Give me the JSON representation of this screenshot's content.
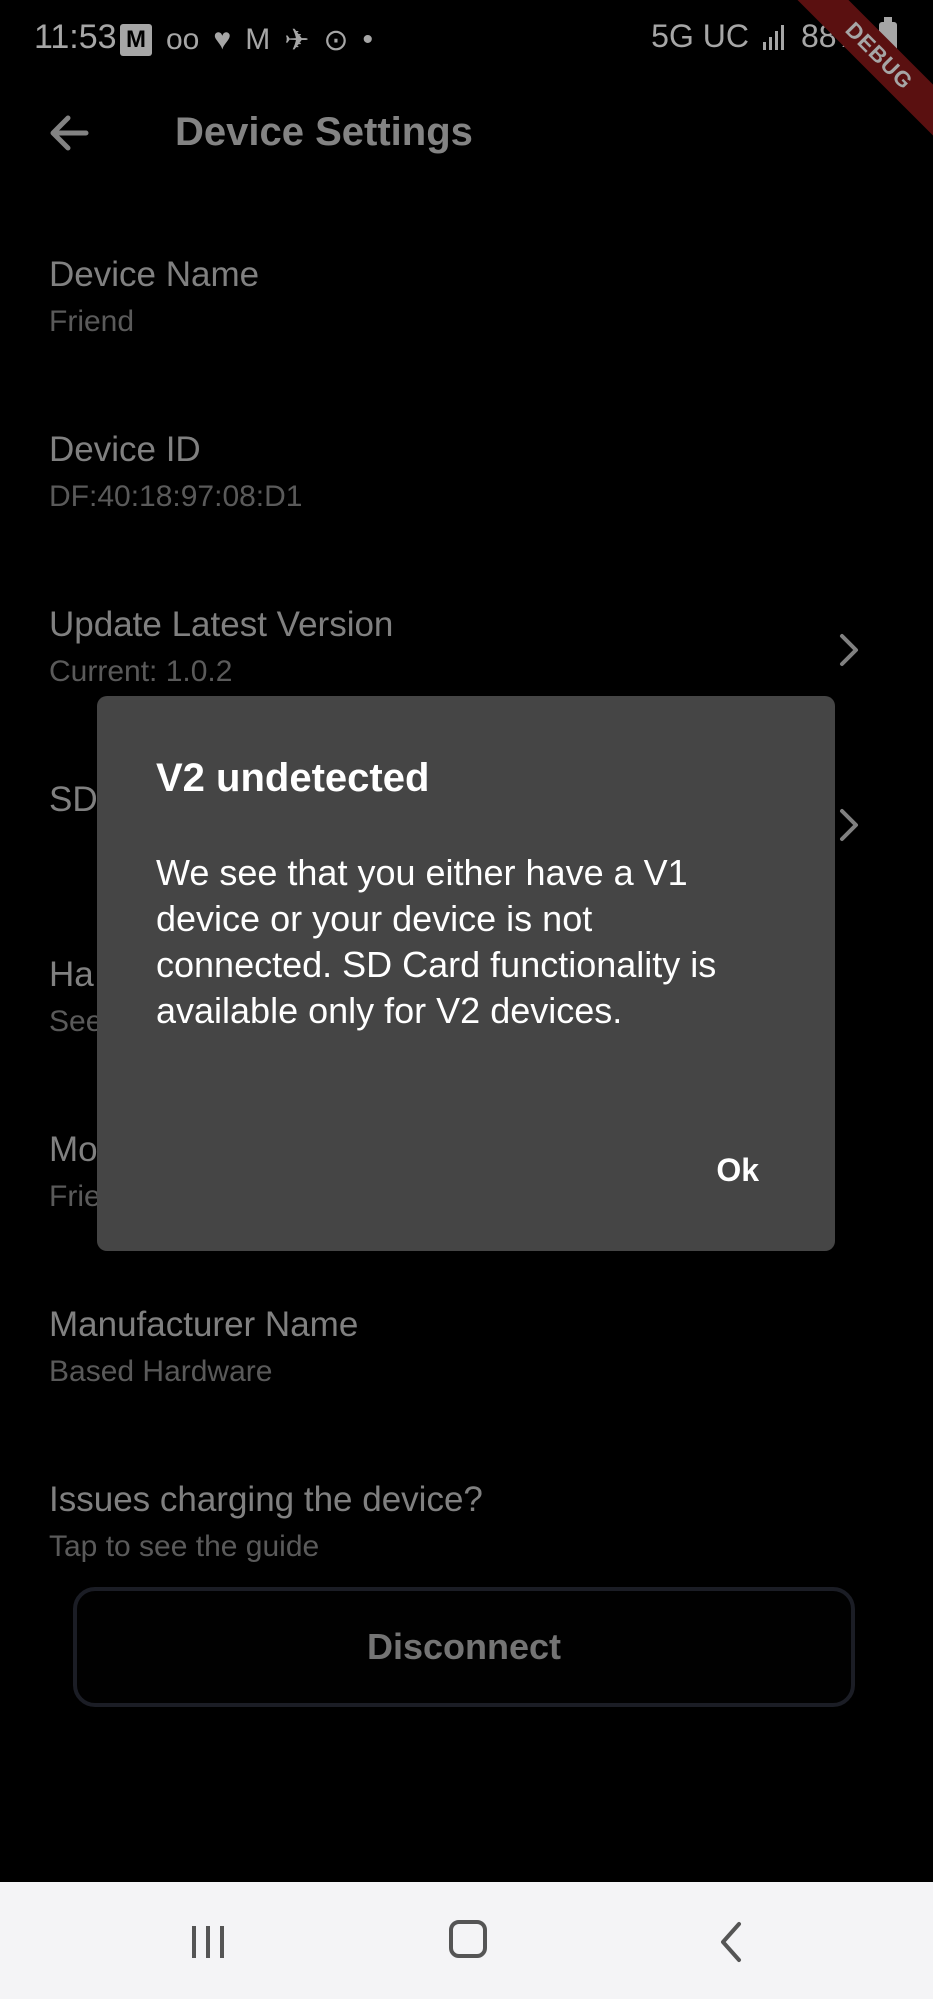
{
  "status_bar": {
    "time": "11:53",
    "icons": [
      "M",
      "oo",
      "♥",
      "M",
      "✈",
      "⊙",
      "•"
    ],
    "network": "5G UC",
    "battery": "88%"
  },
  "debug_banner": "DEBUG",
  "app_bar": {
    "title": "Device Settings"
  },
  "settings": [
    {
      "title": "Device Name",
      "subtitle": "Friend"
    },
    {
      "title": "Device ID",
      "subtitle": "DF:40:18:97:08:D1"
    },
    {
      "title": "Update Latest Version",
      "subtitle": "Current: 1.0.2"
    },
    {
      "title": "SD",
      "subtitle": ""
    },
    {
      "title": "Ha",
      "subtitle": "See"
    },
    {
      "title": "Mo",
      "subtitle": "Frie"
    },
    {
      "title": "Manufacturer Name",
      "subtitle": "Based Hardware"
    },
    {
      "title": "Issues charging the device?",
      "subtitle": "Tap to see the guide"
    }
  ],
  "disconnect_label": "Disconnect",
  "dialog": {
    "title": "V2 undetected",
    "body": "We see that you either have a V1 device or your device is not connected. SD Card functionality is available only for V2 devices.",
    "ok_label": "Ok"
  }
}
